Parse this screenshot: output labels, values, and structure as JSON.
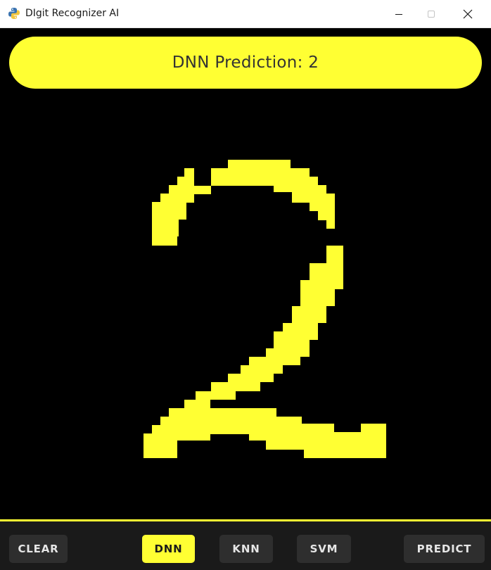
{
  "window": {
    "title": "DIgit Recognizer AI",
    "icons": {
      "app": "python-icon",
      "minimize": "minimize-icon",
      "maximize": "maximize-icon",
      "close": "close-icon"
    }
  },
  "prediction": {
    "text": "DNN Prediction: 2"
  },
  "toolbar": {
    "clear_label": "CLEAR",
    "dnn_label": "DNN",
    "knn_label": "KNN",
    "svm_label": "SVM",
    "predict_label": "PREDICT",
    "active_model": "DNN"
  },
  "colors": {
    "accent": "#ffff33",
    "canvas_background": "#000000",
    "button_background": "#2e2e2e",
    "toolbar_background": "#1a1a1a"
  }
}
